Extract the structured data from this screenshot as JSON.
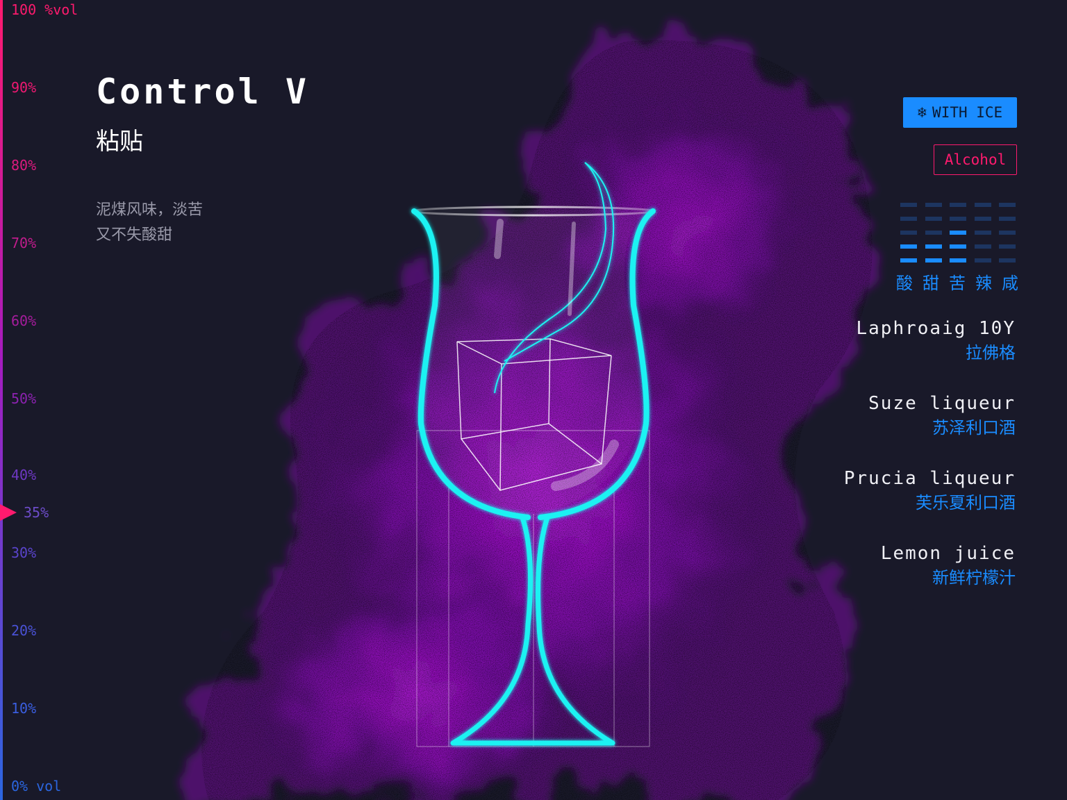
{
  "colors": {
    "background": "#191929",
    "accent_pink": "#ff1a6e",
    "accent_blue": "#1a8cff",
    "glass_cyan": "#1ef2f2",
    "smoke_purple": "#a014c8"
  },
  "abv_scale": {
    "ticks": [
      "100 %vol",
      "90%",
      "80%",
      "70%",
      "60%",
      "50%",
      "40%",
      "30%",
      "20%",
      "10%",
      "0% vol"
    ],
    "marker_label": "35%",
    "marker_value": 35
  },
  "drink": {
    "title_en": "Control V",
    "title_cn": "粘贴",
    "description_lines": [
      "泥煤风味，淡苦",
      "又不失酸甜"
    ]
  },
  "badges": {
    "ice_icon": "snowflake-icon",
    "ice_label": "WITH ICE",
    "alcohol_label": "Alcohol"
  },
  "taste": {
    "labels": [
      "酸",
      "甜",
      "苦",
      "辣",
      "咸"
    ],
    "levels": [
      2,
      2,
      3,
      0,
      0
    ],
    "max_level": 5
  },
  "ingredients": [
    {
      "en": "Laphroaig 10Y",
      "cn": "拉佛格"
    },
    {
      "en": "Suze liqueur",
      "cn": "苏泽利口酒"
    },
    {
      "en": "Prucia liqueur",
      "cn": "芙乐夏利口酒"
    },
    {
      "en": "Lemon juice",
      "cn": "新鲜柠檬汁"
    }
  ]
}
